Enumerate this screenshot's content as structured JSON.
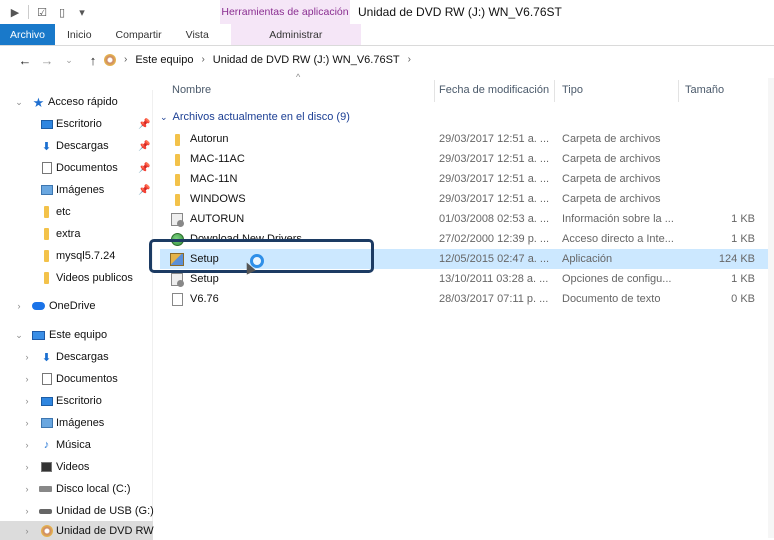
{
  "window": {
    "title": "Unidad de DVD RW (J:) WN_V6.76ST",
    "context_tab_header": "Herramientas de aplicación"
  },
  "ribbon": {
    "tabs": [
      "Archivo",
      "Inicio",
      "Compartir",
      "Vista"
    ],
    "context_tab": "Administrar"
  },
  "address": {
    "breadcrumbs": [
      "Este equipo",
      "Unidad de DVD RW (J:) WN_V6.76ST"
    ]
  },
  "columns": {
    "name": "Nombre",
    "date": "Fecha de modificación",
    "type": "Tipo",
    "size": "Tamaño"
  },
  "group": {
    "label": "Archivos actualmente en el disco (9)"
  },
  "files": [
    {
      "name": "Autorun",
      "date": "29/03/2017 12:51 a. ...",
      "type": "Carpeta de archivos",
      "size": "",
      "icon": "folder-icon"
    },
    {
      "name": "MAC-11AC",
      "date": "29/03/2017 12:51 a. ...",
      "type": "Carpeta de archivos",
      "size": "",
      "icon": "folder-icon"
    },
    {
      "name": "MAC-11N",
      "date": "29/03/2017 12:51 a. ...",
      "type": "Carpeta de archivos",
      "size": "",
      "icon": "folder-icon"
    },
    {
      "name": "WINDOWS",
      "date": "29/03/2017 12:51 a. ...",
      "type": "Carpeta de archivos",
      "size": "",
      "icon": "folder-icon"
    },
    {
      "name": "AUTORUN",
      "date": "01/03/2008 02:53 a. ...",
      "type": "Información sobre la ...",
      "size": "1 KB",
      "icon": "config-file-icon"
    },
    {
      "name": "Download New Drivers",
      "date": "27/02/2000 12:39 p. ...",
      "type": "Acceso directo a Inte...",
      "size": "1 KB",
      "icon": "shortcut-icon"
    },
    {
      "name": "Setup",
      "date": "12/05/2015 02:47 a. ...",
      "type": "Aplicación",
      "size": "124 KB",
      "icon": "setup-app-icon"
    },
    {
      "name": "Setup",
      "date": "13/10/2011 03:28 a. ...",
      "type": "Opciones de configu...",
      "size": "1 KB",
      "icon": "config-file-icon"
    },
    {
      "name": "V6.76",
      "date": "28/03/2017 07:11 p. ...",
      "type": "Documento de texto",
      "size": "0 KB",
      "icon": "text-file-icon"
    }
  ],
  "sidebar": {
    "quick_access": "Acceso rápido",
    "quick_items": [
      "Escritorio",
      "Descargas",
      "Documentos",
      "Imágenes",
      "etc",
      "extra",
      "mysql5.7.24",
      "Videos publicos"
    ],
    "onedrive": "OneDrive",
    "this_pc": "Este equipo",
    "pc_items": [
      "Descargas",
      "Documentos",
      "Escritorio",
      "Imágenes",
      "Música",
      "Videos",
      "Disco local (C:)",
      "Unidad de USB (G:)",
      "Unidad de DVD RW"
    ]
  }
}
